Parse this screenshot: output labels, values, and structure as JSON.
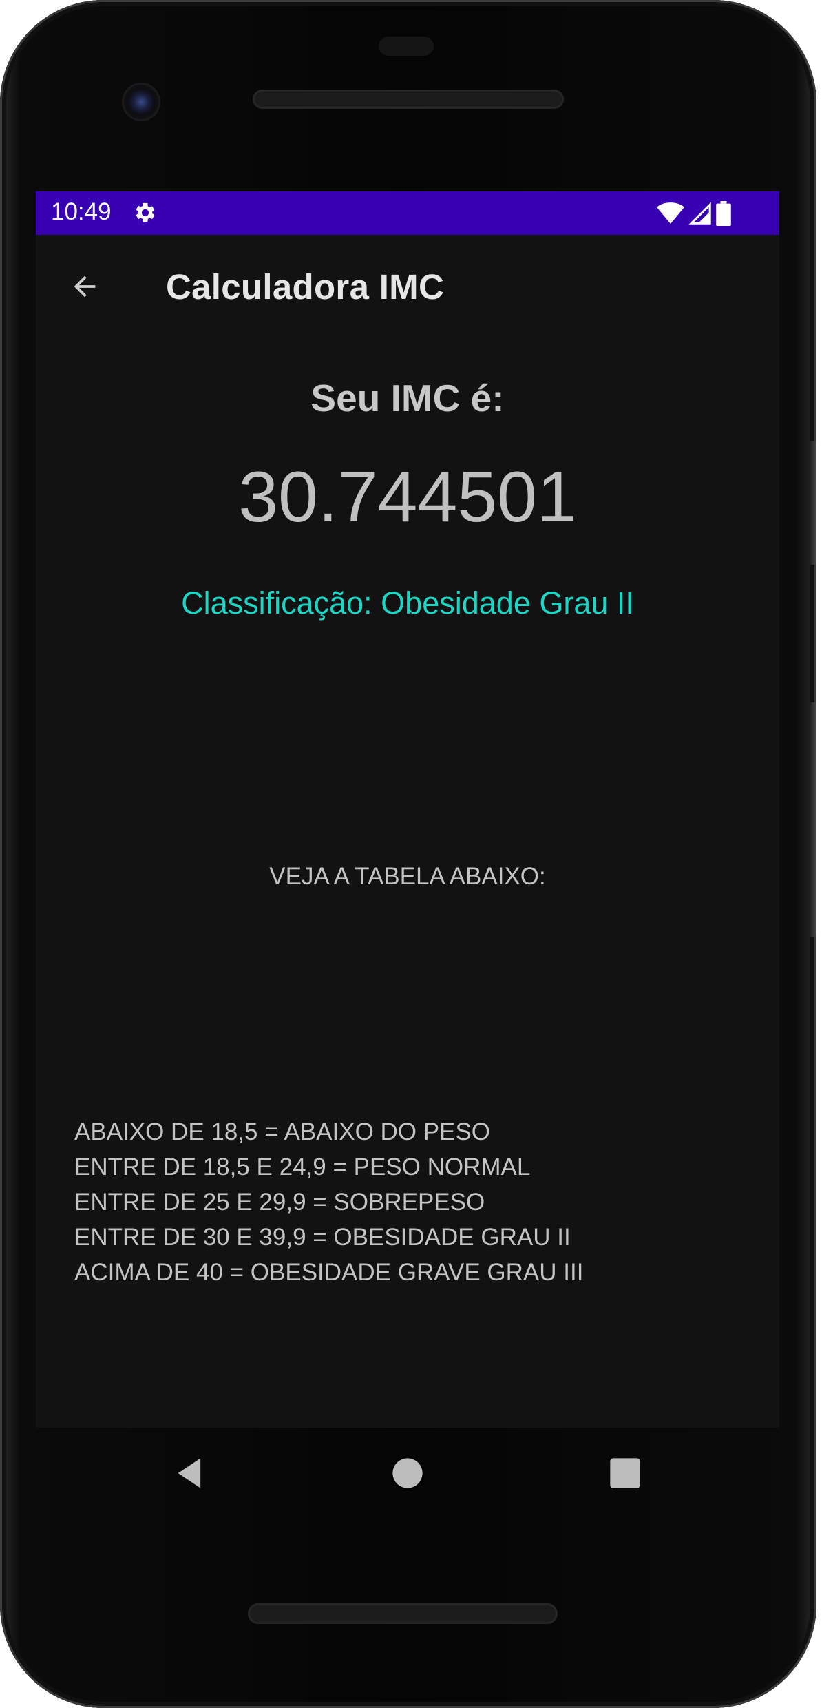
{
  "status_bar": {
    "time": "10:49",
    "background_color": "#3700B3",
    "icons": [
      "gear-icon",
      "wifi-icon",
      "cell-signal-icon",
      "battery-icon"
    ]
  },
  "app_bar": {
    "title": "Calculadora IMC",
    "back_icon": "arrow-back-icon"
  },
  "result": {
    "label": "Seu IMC é:",
    "value": "30.744501",
    "classification": "Classificação: Obesidade Grau II",
    "classification_color": "#1AD7C4"
  },
  "table": {
    "heading": "VEJA A TABELA ABAIXO:",
    "rows": [
      "ABAIXO DE 18,5 = ABAIXO DO PESO",
      "ENTRE DE 18,5 E 24,9 = PESO NORMAL",
      "ENTRE DE 25 E 29,9 = SOBREPESO",
      "ENTRE DE 30 E 39,9 = OBESIDADE GRAU II",
      "ACIMA DE 40 = OBESIDADE GRAVE GRAU III"
    ]
  },
  "navigation": {
    "buttons": [
      "back-triangle-icon",
      "home-circle-icon",
      "recents-square-icon"
    ]
  }
}
